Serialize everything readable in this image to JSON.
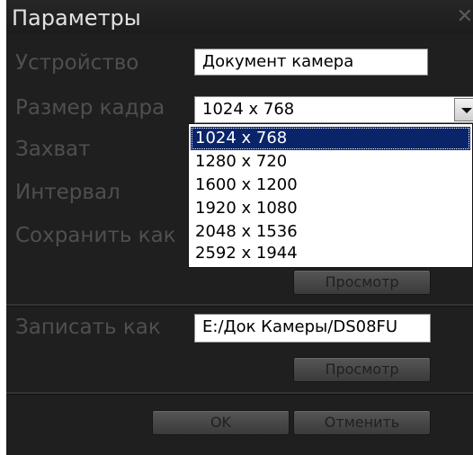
{
  "window": {
    "title": "Параметры",
    "close_icon": "close-icon"
  },
  "labels": {
    "device": "Устройство",
    "frame_size": "Размер кадра",
    "capture": "Захват",
    "interval": "Интервал",
    "save_as": "Сохранить как",
    "record_as": "Записать как"
  },
  "fields": {
    "device_value": "Документ камера",
    "frame_size_value": "1024 x 768",
    "record_path_value": "E:/Док Камеры/DS08FU"
  },
  "frame_size_options": [
    "1024 x 768",
    "1280 x 720",
    "1600 x 1200",
    "1920 x 1080",
    "2048 x 1536",
    "2592 x 1944"
  ],
  "buttons": {
    "browse_save": "Просмотр",
    "browse_record": "Просмотр",
    "ok": "OK",
    "cancel": "Отменить"
  },
  "colors": {
    "dialog_bg": "#1f1f1f",
    "label_text": "#4f4f4f",
    "selection_bg": "#0a246a"
  }
}
